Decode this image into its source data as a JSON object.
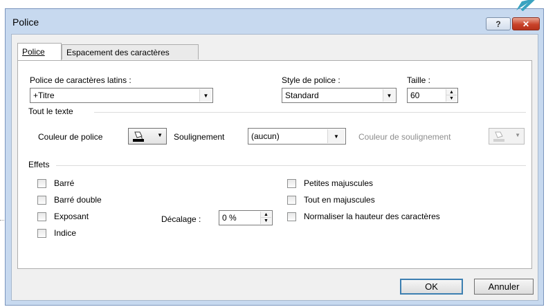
{
  "window": {
    "title": "Police"
  },
  "titlebar": {
    "help_glyph": "?",
    "close_glyph": "✕"
  },
  "tabs": [
    {
      "label": "Police",
      "active": true
    },
    {
      "label": "Espacement des caractères",
      "active": false
    }
  ],
  "font": {
    "latin_label": "Police de caractères latins :",
    "latin_value": "+Titre",
    "style_label": "Style de police :",
    "style_value": "Standard",
    "size_label": "Taille :",
    "size_value": "60"
  },
  "all_text": {
    "header": "Tout le texte",
    "font_color_label": "Couleur de police",
    "underline_label": "Soulignement",
    "underline_value": "(aucun)",
    "underline_color_label": "Couleur de soulignement"
  },
  "effects": {
    "header": "Effets",
    "left": [
      {
        "label": "Barré",
        "checked": false
      },
      {
        "label": "Barré double",
        "checked": false
      },
      {
        "label": "Exposant",
        "checked": false
      },
      {
        "label": "Indice",
        "checked": false
      }
    ],
    "offset_label": "Décalage :",
    "offset_value": "0 %",
    "right": [
      {
        "label": "Petites majuscules",
        "checked": false
      },
      {
        "label": "Tout en majuscules",
        "checked": false
      },
      {
        "label": "Normaliser la hauteur des caractères",
        "checked": false
      }
    ]
  },
  "buttons": {
    "ok": "OK",
    "cancel": "Annuler"
  },
  "colors": {
    "accent_arrow": "#3aa3c0",
    "close_red": "#c9432a",
    "title_bg": "#c7d9ef"
  }
}
